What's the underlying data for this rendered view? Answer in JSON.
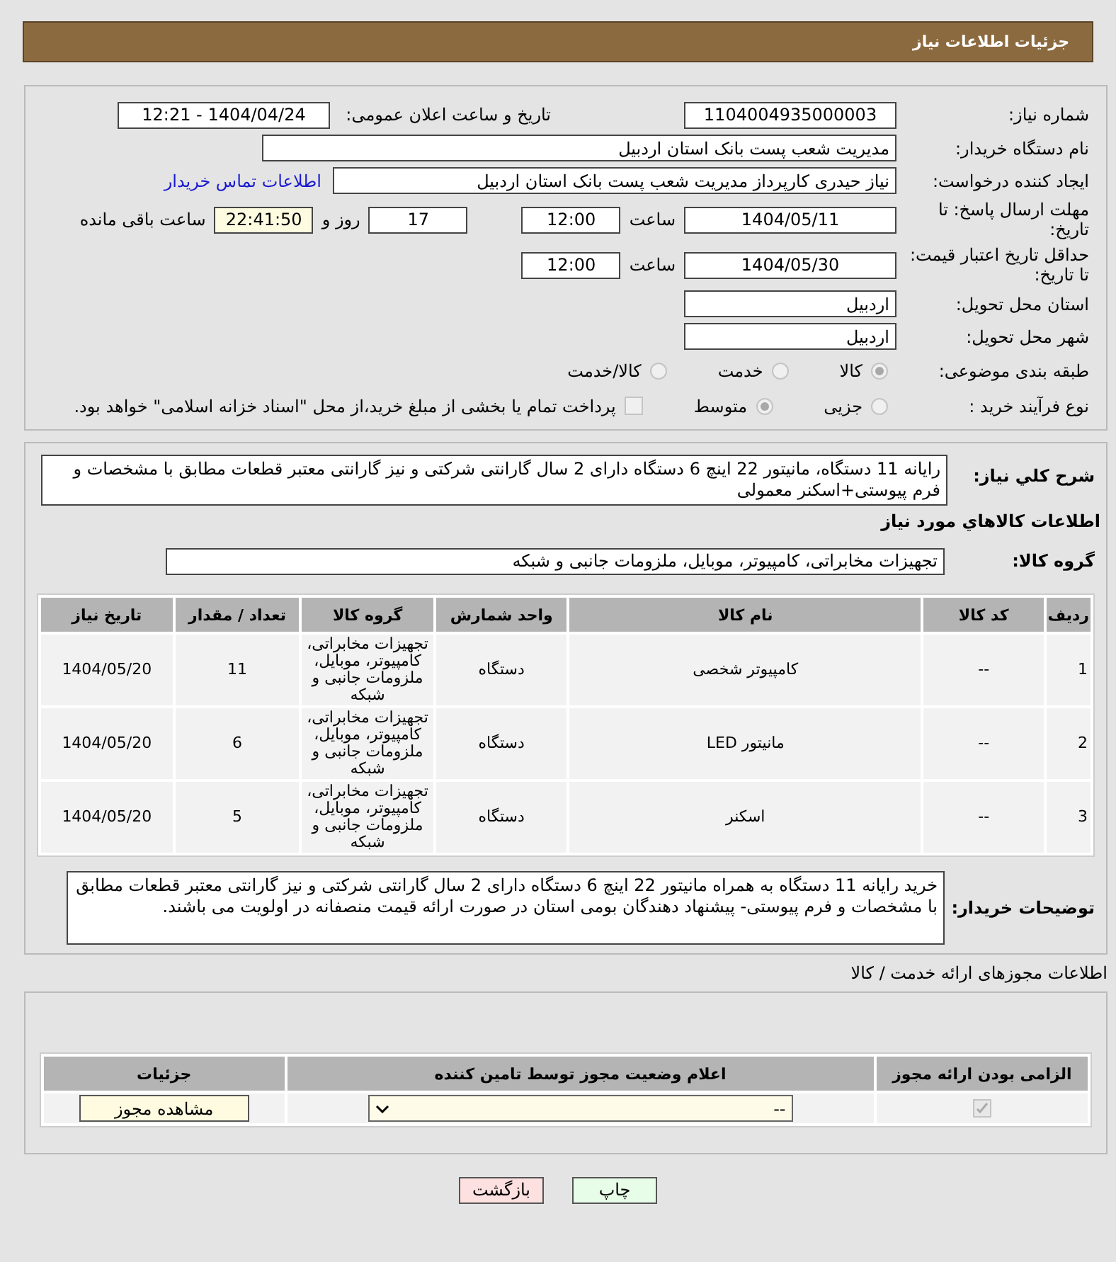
{
  "header": {
    "title": "جزئیات اطلاعات نیاز"
  },
  "need_number": {
    "label": "شماره نیاز:",
    "value": "1104004935000003"
  },
  "announce": {
    "label": "تاریخ و ساعت اعلان عمومی:",
    "value": "1404/04/24 - 12:21"
  },
  "buyer": {
    "label": "نام دستگاه خریدار:",
    "value": "مدیریت شعب پست بانک استان اردبیل"
  },
  "requester": {
    "label": "ایجاد کننده درخواست:",
    "value": "نیاز حیدری کارپرداز مدیریت شعب پست بانک استان اردبیل",
    "link": "اطلاعات تماس خریدار"
  },
  "deadline": {
    "label": "مهلت ارسال پاسخ: تا تاریخ:",
    "date": "1404/05/11",
    "time_label": "ساعت",
    "time": "12:00",
    "days": "17",
    "days_label": "روز و",
    "remaining": "22:41:50",
    "remaining_label": "ساعت باقی مانده"
  },
  "validity": {
    "label": "حداقل تاریخ اعتبار قیمت: تا تاریخ:",
    "date": "1404/05/30",
    "time_label": "ساعت",
    "time": "12:00"
  },
  "province": {
    "label": "استان محل تحویل:",
    "value": "اردبیل"
  },
  "city": {
    "label": "شهر محل تحویل:",
    "value": "اردبیل"
  },
  "category": {
    "label": "طبقه بندی موضوعی:",
    "options": [
      {
        "label": "کالا",
        "selected": true
      },
      {
        "label": "خدمت",
        "selected": false
      },
      {
        "label": "کالا/خدمت",
        "selected": false
      }
    ]
  },
  "process": {
    "label": "نوع فرآیند خرید :",
    "options": [
      {
        "label": "جزیی",
        "selected": false
      },
      {
        "label": "متوسط",
        "selected": true
      }
    ],
    "treasury": {
      "checked": false,
      "text": "پرداخت تمام یا بخشی از مبلغ خرید،از محل \"اسناد خزانه اسلامی\" خواهد بود."
    }
  },
  "description": {
    "label": "شرح کلي نياز:",
    "value": "رایانه 11 دستگاه، مانیتور 22 اینچ 6 دستگاه دارای 2 سال گارانتی شرکتی و نیز گارانتی معتبر قطعات مطابق با مشخصات و فرم پیوستی+اسکنر معمولی"
  },
  "goods": {
    "title": "اطلاعات کالاهاي مورد نياز",
    "group_label": "گروه کالا:",
    "group_value": "تجهیزات مخابراتی، کامپیوتر، موبایل، ملزومات جانبی و شبکه"
  },
  "table": {
    "columns": [
      "ردیف",
      "کد کالا",
      "نام کالا",
      "واحد شمارش",
      "گروه کالا",
      "تعداد / مقدار",
      "تاریخ نیاز"
    ],
    "rows": [
      [
        "1",
        "--",
        "کامپیوتر شخصی",
        "دستگاه",
        "تجهیزات مخابراتی، کامپیوتر، موبایل، ملزومات جانبی و شبکه",
        "11",
        "1404/05/20"
      ],
      [
        "2",
        "--",
        "مانیتور LED",
        "دستگاه",
        "تجهیزات مخابراتی، کامپیوتر، موبایل، ملزومات جانبی و شبکه",
        "6",
        "1404/05/20"
      ],
      [
        "3",
        "--",
        "اسکنر",
        "دستگاه",
        "تجهیزات مخابراتی، کامپیوتر، موبایل، ملزومات جانبی و شبکه",
        "5",
        "1404/05/20"
      ]
    ]
  },
  "buyer_notes": {
    "label": "توضیحات خریدار:",
    "value": "خرید رایانه 11 دستگاه به همراه مانیتور 22 اینچ 6 دستگاه دارای 2 سال گارانتی شرکتی و نیز گارانتی معتبر قطعات مطابق با مشخصات و فرم پیوستی- پیشنهاد دهندگان بومی استان در صورت ارائه قیمت منصفانه در اولویت می باشند."
  },
  "permits": {
    "title": "اطلاعات مجوزهای ارائه خدمت / کالا",
    "columns": [
      "الزامی بودن ارائه مجوز",
      "اعلام وضعیت مجوز توسط تامین کننده",
      "جزئیات"
    ],
    "rows": [
      {
        "required": true,
        "status": "--",
        "button": "مشاهده مجوز"
      }
    ]
  },
  "buttons": [
    {
      "kind": "print",
      "label": "چاپ"
    },
    {
      "kind": "back",
      "label": "بازگشت"
    }
  ]
}
